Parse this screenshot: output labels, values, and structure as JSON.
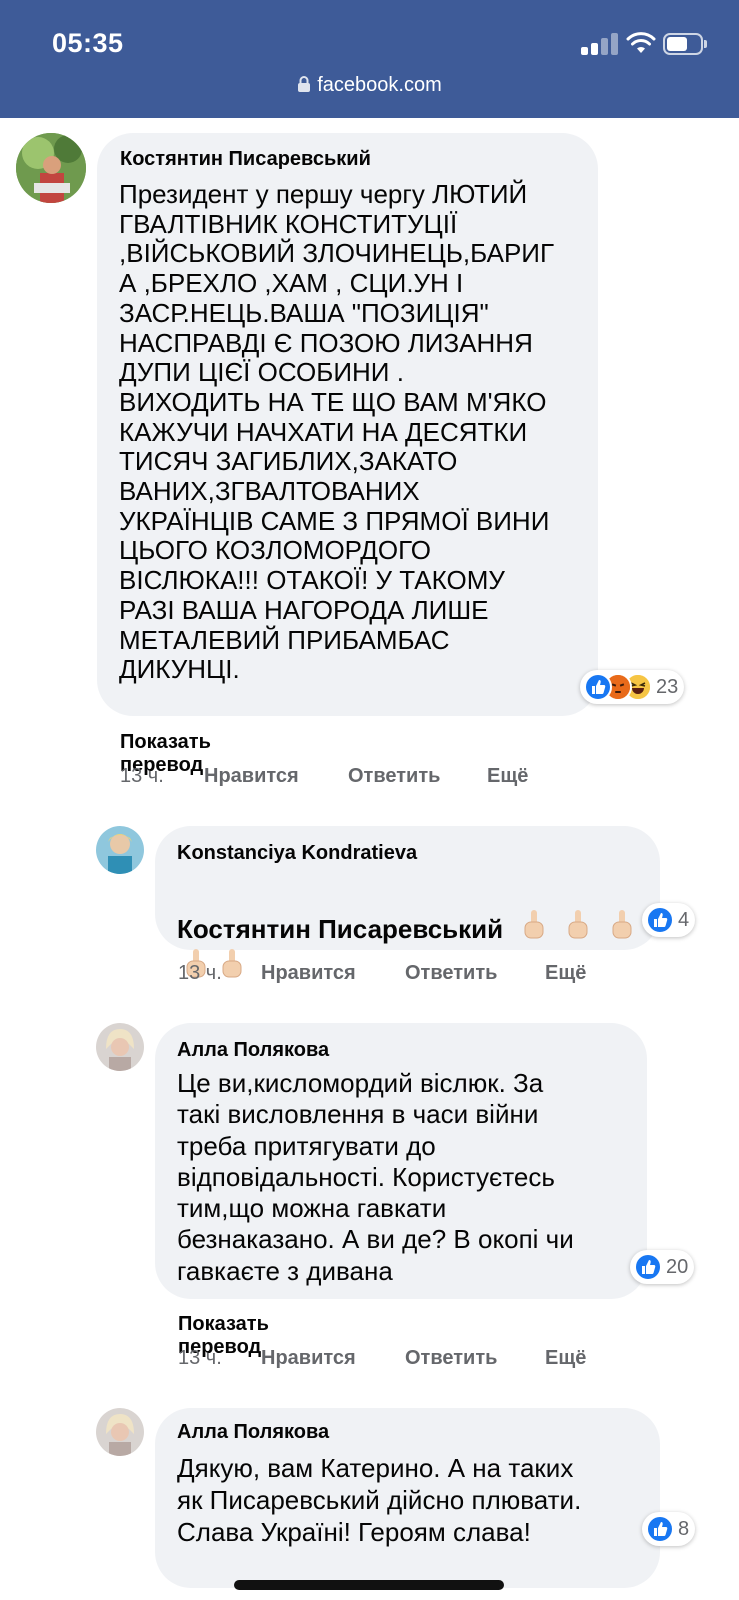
{
  "status_bar": {
    "time": "05:35"
  },
  "browser": {
    "url": "facebook.com"
  },
  "colors": {
    "header": "#3e5b98",
    "bubble": "#f0f2f5",
    "like": "#1877f2",
    "meta_text": "#65676b"
  },
  "comments": [
    {
      "author": "Костянтин Писаревський",
      "text": "Президент у першу чергу ЛЮТИЙ\nГВАЛТІВНИК КОНСТИТУЦІЇ\n,ВІЙСЬКОВИЙ ЗЛОЧИНЕЦЬ,БАРИГ\nА ,БРЕХЛО ,ХАМ , СЦИ.УН І\nЗАСР.НЕЦЬ.ВАША \"ПОЗИЦІЯ\"\nНАСПРАВДІ Є ПОЗОЮ ЛИЗАННЯ\nДУПИ ЦІЄЇ ОСОБИНИ .\nВИХОДИТЬ НА ТЕ ЩО ВАМ М'ЯКО\nКАЖУЧИ НАЧХАТИ НА ДЕСЯТКИ\nТИСЯЧ ЗАГИБЛИХ,ЗАКАТО\nВАНИХ,ЗГВАЛТОВАНИХ\nУКРАЇНЦІВ САМЕ З ПРЯМОЇ ВИНИ\nЦЬОГО КОЗЛОМОРДОГО\nВІСЛЮКА!!! ОТАКОЇ! У ТАКОМУ\nРАЗІ ВАША НАГОРОДА ЛИШЕ\nМЕТАЛЕВИЙ ПРИБАМБАС\nДИКУНЦІ.",
      "reactions": {
        "types": [
          "like-icon",
          "angry-icon",
          "haha-icon"
        ],
        "count": "23"
      },
      "translate": "Показать перевод",
      "time": "13 ч.",
      "like": "Нравится",
      "reply": "Ответить",
      "more": "Ещё"
    },
    {
      "author": "Konstanciya Kondratieva",
      "mention": "Костянтин Писаревський",
      "emojis": [
        "middle-finger-icon",
        "middle-finger-icon",
        "middle-finger-icon",
        "middle-finger-icon",
        "middle-finger-icon"
      ],
      "reactions": {
        "types": [
          "like-icon"
        ],
        "count": "4"
      },
      "time": "13 ч.",
      "like": "Нравится",
      "reply": "Ответить",
      "more": "Ещё"
    },
    {
      "author": "Алла Полякова",
      "text": "Це ви,кисломордий віслюк. За\nтакі висловлення в часи війни\nтреба притягувати до\nвідповідальності. Користуєтесь\nтим,що можна гавкати\nбезнаказано. А ви де? В окопі чи\nгавкаєте з дивана",
      "reactions": {
        "types": [
          "like-icon"
        ],
        "count": "20"
      },
      "translate": "Показать перевод",
      "time": "13 ч.",
      "like": "Нравится",
      "reply": "Ответить",
      "more": "Ещё"
    },
    {
      "author": "Алла Полякова",
      "text": "Дякую, вам Катерино. А на таких\nяк Писаревський дійсно плювати.\nСлава Україні! Героям слава!",
      "reactions": {
        "types": [
          "like-icon"
        ],
        "count": "8"
      }
    }
  ]
}
